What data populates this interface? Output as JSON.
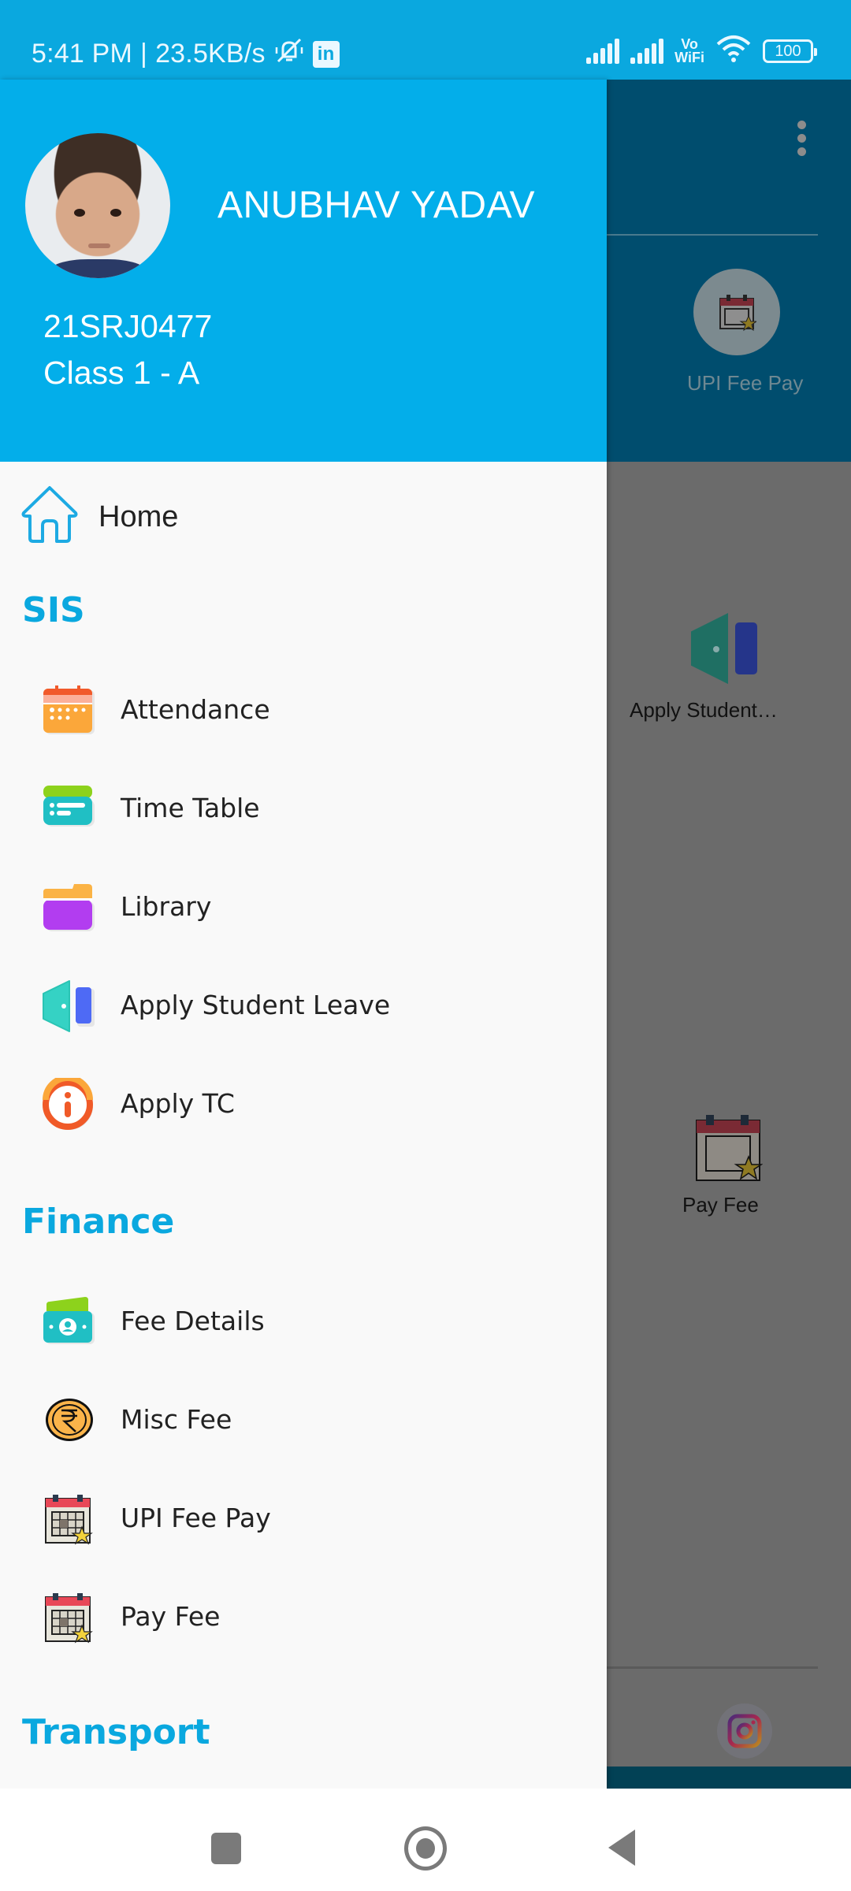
{
  "status_bar": {
    "time": "5:41 PM",
    "separator": "|",
    "network_speed": "23.5KB/s",
    "icons": [
      "silent-bell-icon",
      "linkedin-icon",
      "signal-icon",
      "signal-icon",
      "vowifi-icon",
      "wifi-icon",
      "battery-icon"
    ],
    "linkedin_glyph": "in",
    "vowifi_top": "Vo",
    "vowifi_bottom": "WiFi",
    "battery": "100"
  },
  "drawer": {
    "profile": {
      "name": "ANUBHAV YADAV",
      "id": "21SRJ0477",
      "class": "Class 1 - A"
    },
    "home": {
      "label": "Home",
      "icon": "home-icon"
    },
    "sections": [
      {
        "title": "SIS",
        "items": [
          {
            "label": "Attendance",
            "icon": "calendar-icon"
          },
          {
            "label": "Time Table",
            "icon": "timetable-icon"
          },
          {
            "label": "Library",
            "icon": "folder-icon"
          },
          {
            "label": "Apply Student Leave",
            "icon": "door-icon"
          },
          {
            "label": "Apply TC",
            "icon": "info-icon"
          }
        ]
      },
      {
        "title": "Finance",
        "items": [
          {
            "label": "Fee Details",
            "icon": "money-icon"
          },
          {
            "label": "Misc Fee",
            "icon": "rupee-coin-icon"
          },
          {
            "label": "UPI Fee Pay",
            "icon": "calendar-star-icon"
          },
          {
            "label": "Pay Fee",
            "icon": "calendar-star-icon"
          }
        ]
      },
      {
        "title": "Transport",
        "items": []
      }
    ]
  },
  "background_app": {
    "tiles": [
      {
        "label": "UPI Fee Pay",
        "icon": "calendar-star-icon"
      },
      {
        "label": "Apply Student…",
        "icon": "door-icon"
      },
      {
        "label": "Pay Fee",
        "icon": "calendar-star-icon"
      }
    ],
    "social": [
      "instagram-icon"
    ]
  },
  "colors": {
    "accent": "#03aeea",
    "status_bar": "#0aa8df",
    "drawer_bg": "#f9f9f9",
    "text": "#222222",
    "scrim_appbar": "#004d6e"
  }
}
